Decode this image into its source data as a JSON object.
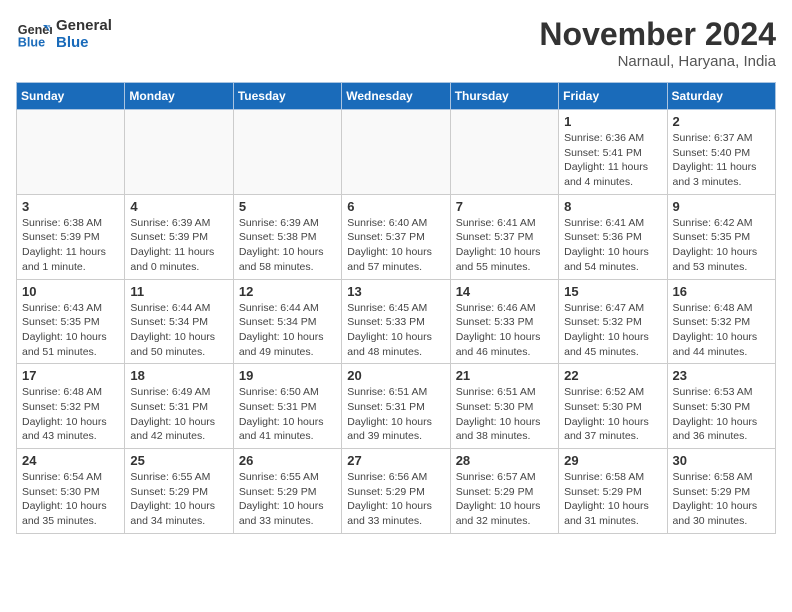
{
  "header": {
    "logo_line1": "General",
    "logo_line2": "Blue",
    "month_title": "November 2024",
    "location": "Narnaul, Haryana, India"
  },
  "weekdays": [
    "Sunday",
    "Monday",
    "Tuesday",
    "Wednesday",
    "Thursday",
    "Friday",
    "Saturday"
  ],
  "weeks": [
    [
      {
        "day": "",
        "info": ""
      },
      {
        "day": "",
        "info": ""
      },
      {
        "day": "",
        "info": ""
      },
      {
        "day": "",
        "info": ""
      },
      {
        "day": "",
        "info": ""
      },
      {
        "day": "1",
        "info": "Sunrise: 6:36 AM\nSunset: 5:41 PM\nDaylight: 11 hours and 4 minutes."
      },
      {
        "day": "2",
        "info": "Sunrise: 6:37 AM\nSunset: 5:40 PM\nDaylight: 11 hours and 3 minutes."
      }
    ],
    [
      {
        "day": "3",
        "info": "Sunrise: 6:38 AM\nSunset: 5:39 PM\nDaylight: 11 hours and 1 minute."
      },
      {
        "day": "4",
        "info": "Sunrise: 6:39 AM\nSunset: 5:39 PM\nDaylight: 11 hours and 0 minutes."
      },
      {
        "day": "5",
        "info": "Sunrise: 6:39 AM\nSunset: 5:38 PM\nDaylight: 10 hours and 58 minutes."
      },
      {
        "day": "6",
        "info": "Sunrise: 6:40 AM\nSunset: 5:37 PM\nDaylight: 10 hours and 57 minutes."
      },
      {
        "day": "7",
        "info": "Sunrise: 6:41 AM\nSunset: 5:37 PM\nDaylight: 10 hours and 55 minutes."
      },
      {
        "day": "8",
        "info": "Sunrise: 6:41 AM\nSunset: 5:36 PM\nDaylight: 10 hours and 54 minutes."
      },
      {
        "day": "9",
        "info": "Sunrise: 6:42 AM\nSunset: 5:35 PM\nDaylight: 10 hours and 53 minutes."
      }
    ],
    [
      {
        "day": "10",
        "info": "Sunrise: 6:43 AM\nSunset: 5:35 PM\nDaylight: 10 hours and 51 minutes."
      },
      {
        "day": "11",
        "info": "Sunrise: 6:44 AM\nSunset: 5:34 PM\nDaylight: 10 hours and 50 minutes."
      },
      {
        "day": "12",
        "info": "Sunrise: 6:44 AM\nSunset: 5:34 PM\nDaylight: 10 hours and 49 minutes."
      },
      {
        "day": "13",
        "info": "Sunrise: 6:45 AM\nSunset: 5:33 PM\nDaylight: 10 hours and 48 minutes."
      },
      {
        "day": "14",
        "info": "Sunrise: 6:46 AM\nSunset: 5:33 PM\nDaylight: 10 hours and 46 minutes."
      },
      {
        "day": "15",
        "info": "Sunrise: 6:47 AM\nSunset: 5:32 PM\nDaylight: 10 hours and 45 minutes."
      },
      {
        "day": "16",
        "info": "Sunrise: 6:48 AM\nSunset: 5:32 PM\nDaylight: 10 hours and 44 minutes."
      }
    ],
    [
      {
        "day": "17",
        "info": "Sunrise: 6:48 AM\nSunset: 5:32 PM\nDaylight: 10 hours and 43 minutes."
      },
      {
        "day": "18",
        "info": "Sunrise: 6:49 AM\nSunset: 5:31 PM\nDaylight: 10 hours and 42 minutes."
      },
      {
        "day": "19",
        "info": "Sunrise: 6:50 AM\nSunset: 5:31 PM\nDaylight: 10 hours and 41 minutes."
      },
      {
        "day": "20",
        "info": "Sunrise: 6:51 AM\nSunset: 5:31 PM\nDaylight: 10 hours and 39 minutes."
      },
      {
        "day": "21",
        "info": "Sunrise: 6:51 AM\nSunset: 5:30 PM\nDaylight: 10 hours and 38 minutes."
      },
      {
        "day": "22",
        "info": "Sunrise: 6:52 AM\nSunset: 5:30 PM\nDaylight: 10 hours and 37 minutes."
      },
      {
        "day": "23",
        "info": "Sunrise: 6:53 AM\nSunset: 5:30 PM\nDaylight: 10 hours and 36 minutes."
      }
    ],
    [
      {
        "day": "24",
        "info": "Sunrise: 6:54 AM\nSunset: 5:30 PM\nDaylight: 10 hours and 35 minutes."
      },
      {
        "day": "25",
        "info": "Sunrise: 6:55 AM\nSunset: 5:29 PM\nDaylight: 10 hours and 34 minutes."
      },
      {
        "day": "26",
        "info": "Sunrise: 6:55 AM\nSunset: 5:29 PM\nDaylight: 10 hours and 33 minutes."
      },
      {
        "day": "27",
        "info": "Sunrise: 6:56 AM\nSunset: 5:29 PM\nDaylight: 10 hours and 33 minutes."
      },
      {
        "day": "28",
        "info": "Sunrise: 6:57 AM\nSunset: 5:29 PM\nDaylight: 10 hours and 32 minutes."
      },
      {
        "day": "29",
        "info": "Sunrise: 6:58 AM\nSunset: 5:29 PM\nDaylight: 10 hours and 31 minutes."
      },
      {
        "day": "30",
        "info": "Sunrise: 6:58 AM\nSunset: 5:29 PM\nDaylight: 10 hours and 30 minutes."
      }
    ]
  ]
}
